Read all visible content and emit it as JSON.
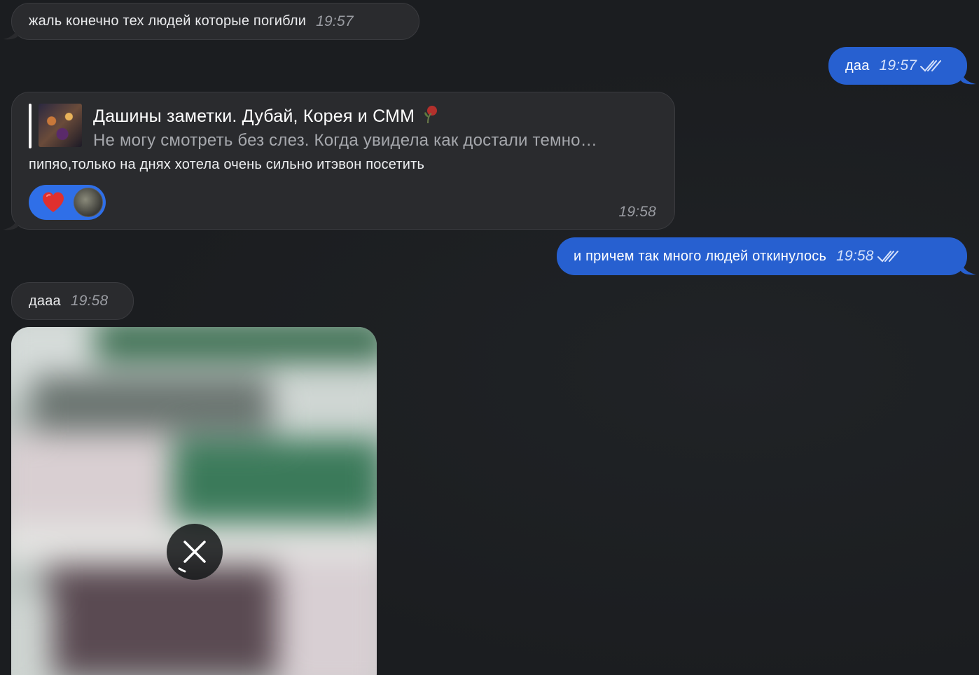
{
  "messages": {
    "m1": {
      "text": "жаль конечно тех людей которые погибли",
      "time": "19:57"
    },
    "m2": {
      "text": "даа",
      "time": "19:57"
    },
    "m3": {
      "reply_title": "Дашины заметки. Дубай, Корея и СММ",
      "reply_snippet": "Не могу смотреть без слез. Когда увидела как достали темно…",
      "text": "пипяо,только на днях хотела очень сильно итэвон посетить",
      "time": "19:58"
    },
    "m4": {
      "text": "и причем так много людей откинулось",
      "time": "19:58"
    },
    "m5": {
      "text": "дааа",
      "time": "19:58"
    }
  },
  "reactions": [
    {
      "icon": "heart-icon",
      "color": "#e0302e"
    }
  ],
  "colors": {
    "background": "#1b1d20",
    "incoming_bubble": "#2a2b2e",
    "outgoing_bubble": "#2760d0",
    "reaction_pill": "#2f6fe8"
  },
  "media": {
    "state": "downloading",
    "cancel_icon": "close-icon"
  }
}
